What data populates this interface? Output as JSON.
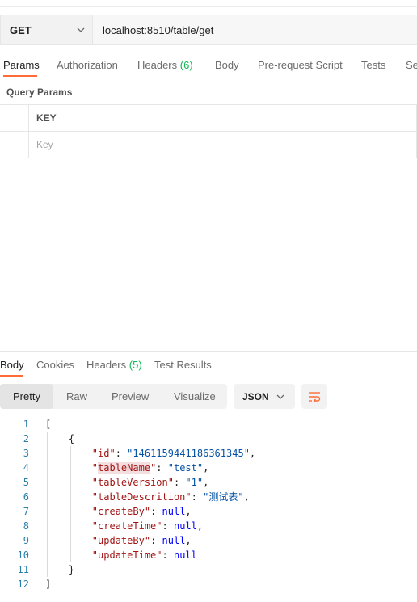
{
  "request": {
    "method": "GET",
    "url": "localhost:8510/table/get"
  },
  "request_tabs": [
    {
      "label": "Params",
      "count": ""
    },
    {
      "label": "Authorization",
      "count": ""
    },
    {
      "label": "Headers",
      "count": "(6)"
    },
    {
      "label": "Body",
      "count": ""
    },
    {
      "label": "Pre-request Script",
      "count": ""
    },
    {
      "label": "Tests",
      "count": ""
    },
    {
      "label": "Se",
      "count": ""
    }
  ],
  "query_params": {
    "title": "Query Params",
    "header_key": "KEY",
    "key_placeholder": "Key"
  },
  "response_tabs": [
    {
      "label": "Body",
      "count": ""
    },
    {
      "label": "Cookies",
      "count": ""
    },
    {
      "label": "Headers",
      "count": "(5)"
    },
    {
      "label": "Test Results",
      "count": ""
    }
  ],
  "view_modes": [
    "Pretty",
    "Raw",
    "Preview",
    "Visualize"
  ],
  "format": "JSON",
  "icons": {
    "method_dropdown": "chevron-down-icon",
    "format_dropdown": "chevron-down-icon",
    "wrap": "wrap-lines-icon"
  },
  "colors": {
    "accent": "#ff6c37",
    "count": "#0cbb52",
    "json_key": "#a31515",
    "json_string": "#0451a5",
    "json_null": "#0000ff",
    "line_number": "#2a7fa8"
  },
  "response_body": {
    "fields": [
      {
        "key": "id",
        "value": "1461159441186361345",
        "type": "string"
      },
      {
        "key": "tableName",
        "value": "test",
        "type": "string"
      },
      {
        "key": "tableVersion",
        "value": "1",
        "type": "string"
      },
      {
        "key": "tableDescrition",
        "value": "测试表",
        "type": "string"
      },
      {
        "key": "createBy",
        "value": "null",
        "type": "null"
      },
      {
        "key": "createTime",
        "value": "null",
        "type": "null"
      },
      {
        "key": "updateBy",
        "value": "null",
        "type": "null"
      },
      {
        "key": "updateTime",
        "value": "null",
        "type": "null"
      }
    ],
    "line_numbers": [
      "1",
      "2",
      "3",
      "4",
      "5",
      "6",
      "7",
      "8",
      "9",
      "10",
      "11",
      "12"
    ],
    "open_bracket": "[",
    "close_bracket": "]",
    "open_brace": "{",
    "close_brace": "}"
  }
}
